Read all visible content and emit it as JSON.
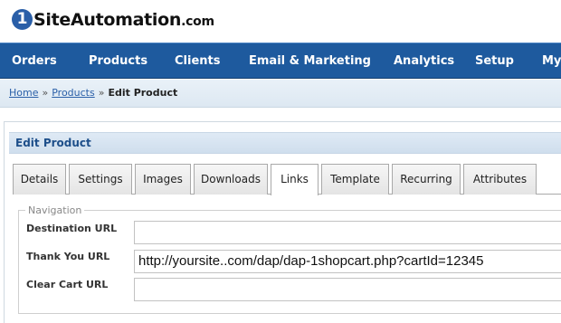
{
  "logo": {
    "badge": "1",
    "text": "SiteAutomation",
    "domain": ".com"
  },
  "nav": {
    "items": [
      "Orders",
      "Products",
      "Clients",
      "Email & Marketing",
      "Analytics",
      "Setup",
      "My"
    ]
  },
  "breadcrumb": {
    "home": "Home",
    "sep": "»",
    "products": "Products",
    "current": "Edit Product"
  },
  "panel": {
    "title": "Edit Product"
  },
  "tabs": [
    "Details",
    "Settings",
    "Images",
    "Downloads",
    "Links",
    "Template",
    "Recurring",
    "Attributes"
  ],
  "active_tab": "Links",
  "navigation": {
    "legend": "Navigation",
    "destination_label": "Destination URL",
    "destination_value": "",
    "thankyou_label": "Thank You URL",
    "thankyou_value": "http://yoursite..com/dap/dap-1shopcart.php?cartId=12345",
    "clearcart_label": "Clear Cart URL",
    "clearcart_value": ""
  },
  "colors": {
    "nav_bg": "#1e5a9e",
    "link": "#2a5fa8",
    "panel_title": "#1e4f8a"
  }
}
